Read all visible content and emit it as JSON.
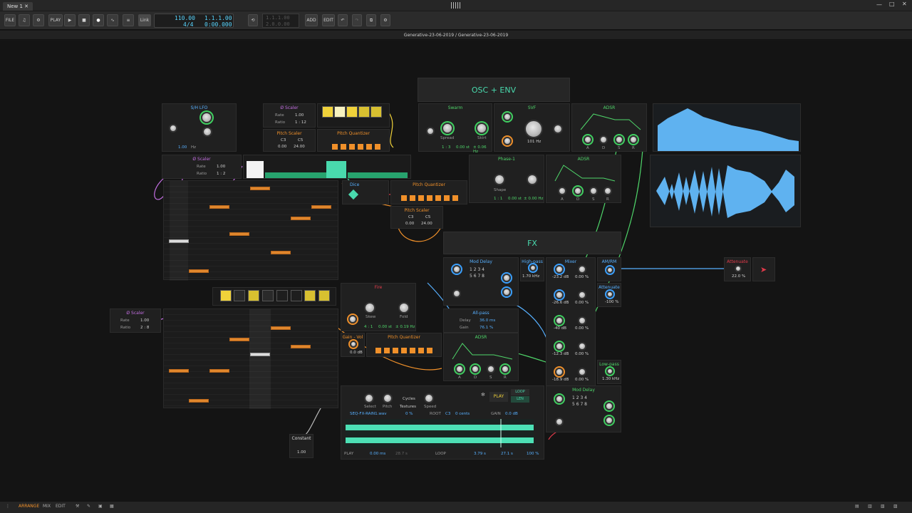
{
  "window": {
    "tab_label": "New 1",
    "doc_path": "Generative-23-06-2019 / Generative-23-06-2019"
  },
  "transport": {
    "file": "FILE",
    "play_label": "PLAY",
    "link": "Link",
    "tempo": "110.00",
    "time_sig": "4/4",
    "position": "1.1.1.00",
    "time": "0:00.000",
    "loop_start": "1.1.1.00",
    "loop_end": "2.0.0.00",
    "add": "ADD",
    "edit": "EDIT"
  },
  "sections": {
    "osc_env": "OSC + ENV",
    "fx": "FX"
  },
  "devices": {
    "sh_lfo": {
      "title": "S/H LFO",
      "rate": "1.00",
      "unit": "Hz"
    },
    "scaler1": {
      "title": "Ø Scaler",
      "rate_label": "Rate",
      "rate": "1.00",
      "ratio_label": "Ratio",
      "ratio": "1 : 12"
    },
    "pitch_scaler1": {
      "title": "Pitch Scaler",
      "low": "C3",
      "high": "C5",
      "v1": "0.00",
      "v2": "24.00"
    },
    "pitch_quantizer1": {
      "title": "Pitch Quantizer"
    },
    "scaler2": {
      "title": "Ø Scaler",
      "rate_label": "Rate",
      "rate": "1.00",
      "ratio_label": "Ratio",
      "ratio": "1 : 2"
    },
    "dice": {
      "title": "Dice"
    },
    "pitch_quantizer2": {
      "title": "Pitch Quantizer"
    },
    "pitch_scaler2": {
      "title": "Pitch Scaler",
      "low": "C3",
      "high": "C5",
      "v1": "0.00",
      "v2": "24.00"
    },
    "swarm": {
      "title": "Swarm",
      "spread": "Spread",
      "skirt": "Skirt",
      "ratio": "1 : 3",
      "st": "0.00 st",
      "hz": "± 0.06 Hz"
    },
    "svf": {
      "title": "SVF",
      "freq": "101 Hz"
    },
    "adsr1": {
      "title": "ADSR",
      "a": "A",
      "d": "D",
      "s": "S",
      "r": "R"
    },
    "phase1": {
      "title": "Phase-1",
      "shape": "Shape",
      "ratio": "1 : 1",
      "st": "0.00 st",
      "hz": "± 0.00 Hz"
    },
    "adsr2": {
      "title": "ADSR",
      "a": "A",
      "d": "D",
      "s": "S",
      "r": "R"
    },
    "mod_delay": {
      "title": "Mod Delay"
    },
    "high_pass": {
      "title": "High-pass",
      "freq": "1.70 kHz"
    },
    "mixer": {
      "title": "Mixer",
      "v1": "-23.2 dB",
      "v2": "0.00 %",
      "v3": "-26.6 dB",
      "v4": "0.00 %",
      "v5": "-40 dB",
      "v6": "0.00 %",
      "v7": "-12.3 dB",
      "v8": "0.00 %",
      "v9": "-18.9 dB",
      "v10": "0.00 %"
    },
    "am_rm": {
      "title": "AM/RM"
    },
    "attenuate1": {
      "title": "Attenuate",
      "val": "-100 %"
    },
    "attenuate2": {
      "title": "Attenuate",
      "val": "22.0 %"
    },
    "allpass": {
      "title": "All-pass",
      "delay_label": "Delay",
      "delay": "36.0 ms",
      "gain_label": "Gain",
      "gain": "76.1 %"
    },
    "fire": {
      "title": "Fire",
      "skew": "Skew",
      "fold": "Fold",
      "ratio": "4 : 1",
      "st": "0.00 st",
      "hz": "± 0.19 Hz"
    },
    "gain_vol": {
      "title": "Gain - Vol",
      "val": "0.0 dB"
    },
    "pitch_quantizer3": {
      "title": "Pitch Quantizer"
    },
    "adsr3": {
      "title": "ADSR",
      "a": "A",
      "d": "D",
      "s": "S",
      "r": "R"
    },
    "scaler3": {
      "title": "Ø Scaler",
      "rate_label": "Rate",
      "rate": "1.00",
      "ratio_label": "Ratio",
      "ratio": "2 : 8"
    },
    "low_pass": {
      "title": "Low-pass",
      "freq": "1.30 kHz"
    },
    "mod_delay2": {
      "title": "Mod Delay"
    },
    "constant": {
      "title": "Constant",
      "val": "1.00"
    },
    "sampler": {
      "select": "Select",
      "pitch": "Pitch",
      "cycles": "Cycles",
      "textures": "Textures",
      "speed": "Speed",
      "play": "PLAY",
      "loop": "LOOP",
      "len": "LEN",
      "file": "SEQ-FX-RAIN1.wav",
      "pct": "0 %",
      "root_label": "ROOT",
      "root": "C3",
      "cents": "0 cents",
      "gain_label": "GAIN",
      "gain": "0.0 dB",
      "play2": "PLAY",
      "start": "0.00 ms",
      "len_val": "28.7 s",
      "loop2": "LOOP",
      "loop_start": "3.79 s",
      "loop_len": "27.1 s",
      "pct2": "100 %"
    }
  },
  "footer": {
    "arrange": "ARRANGE",
    "mix": "MIX",
    "edit": "EDIT"
  },
  "colors": {
    "accent": "#f0902a",
    "teal": "#49d9ad",
    "blue": "#57b0ff",
    "purple": "#c26ee0",
    "green": "#4fd66a"
  }
}
